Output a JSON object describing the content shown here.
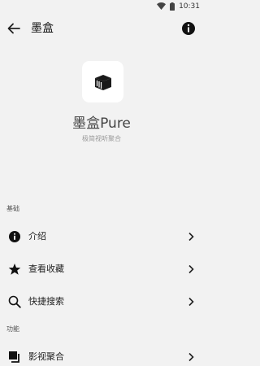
{
  "status_bar": {
    "time": "10:31",
    "icons": [
      "wifi-icon",
      "battery-icon"
    ]
  },
  "app_bar": {
    "title": "墨盒",
    "back_icon": "arrow-left-icon",
    "info_icon": "info-icon"
  },
  "about": {
    "logo_icon": "ink-box-logo-icon",
    "app_name": "墨盒Pure",
    "tagline": "极简视听聚合"
  },
  "sections": [
    {
      "header": "基础",
      "items": [
        {
          "label": "介绍",
          "icon": "info-icon"
        },
        {
          "label": "查看收藏",
          "icon": "star-icon"
        },
        {
          "label": "快捷搜索",
          "icon": "search-icon"
        }
      ]
    },
    {
      "header": "功能",
      "items": [
        {
          "label": "影视聚合",
          "icon": "library-icon"
        }
      ]
    }
  ],
  "colors": {
    "background": "#f2f2f2",
    "card": "#ffffff",
    "text": "#222222",
    "muted": "#999999"
  }
}
